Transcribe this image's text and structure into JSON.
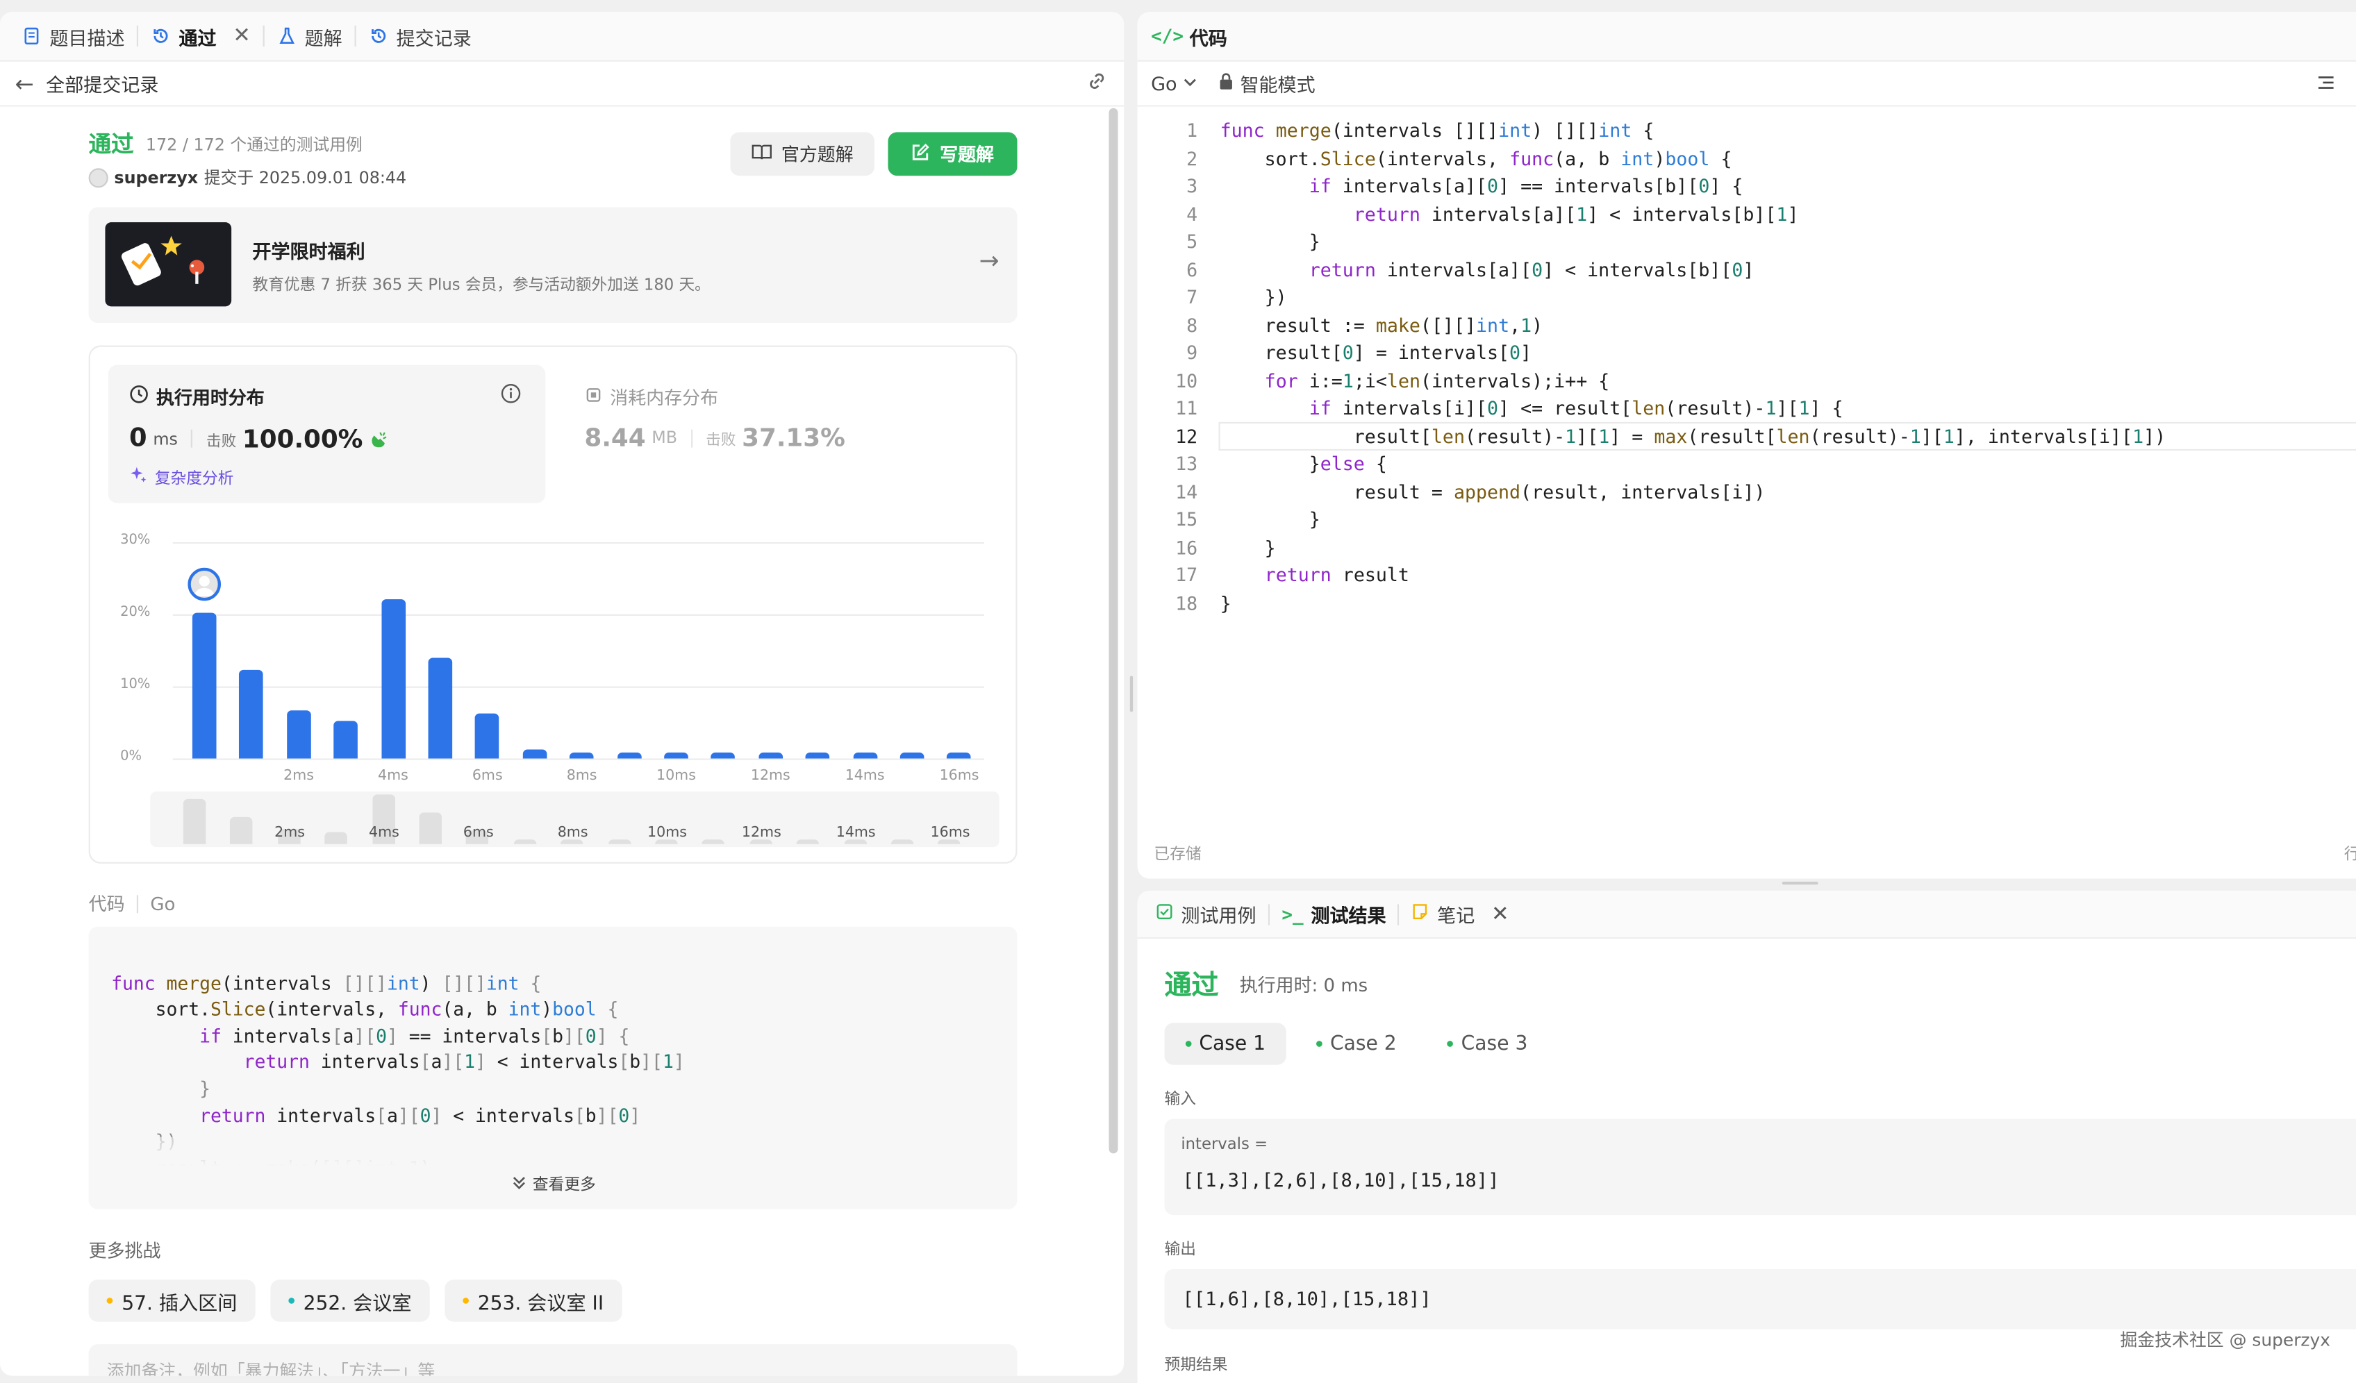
{
  "left_tabs": [
    {
      "label": "题目描述"
    },
    {
      "label": "通过"
    },
    {
      "label": "题解"
    },
    {
      "label": "提交记录"
    }
  ],
  "back_label": "全部提交记录",
  "submission": {
    "status": "通过",
    "passed_text": "172 / 172 个通过的测试用例",
    "user": "superzyx",
    "submitted_text": "提交于 2025.09.01 08:44",
    "official_btn": "官方题解",
    "write_btn": "写题解"
  },
  "promo": {
    "title": "开学限时福利",
    "desc": "教育优惠 7 折获 365 天 Plus 会员，参与活动额外加送 180 天。"
  },
  "runtime": {
    "title": "执行用时分布",
    "value": "0",
    "unit": "ms",
    "beat_label": "击败",
    "beat": "100.00%",
    "complexity": "复杂度分析"
  },
  "memory": {
    "title": "消耗内存分布",
    "value": "8.44",
    "unit": "MB",
    "beat_label": "击败",
    "beat": "37.13%"
  },
  "chart_data": {
    "type": "bar",
    "ylabels": [
      "30%",
      "20%",
      "10%",
      "0%"
    ],
    "ylim": [
      0,
      30
    ],
    "xlabels": [
      "2ms",
      "4ms",
      "6ms",
      "8ms",
      "10ms",
      "12ms",
      "14ms",
      "16ms"
    ],
    "values": [
      20.2,
      12.2,
      6.6,
      5.2,
      22,
      14,
      6.2,
      1.2,
      0.8,
      0.8,
      0.8,
      0.8,
      0.8,
      0.8,
      0.8,
      0.8,
      0.8
    ],
    "highlight_index": 0
  },
  "code_header": {
    "label": "代码",
    "lang": "Go"
  },
  "code_lines": [
    "func merge(intervals [][]int) [][]int {",
    "    sort.Slice(intervals, func(a, b int)bool {",
    "        if intervals[a][0] == intervals[b][0] {",
    "            return intervals[a][1] < intervals[b][1]",
    "        }",
    "        return intervals[a][0] < intervals[b][0]",
    "    })",
    "    result := make([][]int,1)",
    "    result[0] = intervals[0]",
    "    for i:=1;i<len(intervals);i++ {",
    "        if intervals[i][0] <= result[len(result)-1][1] {",
    "            result[len(result)-1][1] = max(result[len(result)-1][1], intervals[i][1])",
    "        }else {",
    "            result = append(result, intervals[i])",
    "        }",
    "    }",
    "    return result",
    "}"
  ],
  "view_more": "查看更多",
  "more_challenges": {
    "title": "更多挑战",
    "items": [
      {
        "label": "57. 插入区间",
        "color": "#ffb800"
      },
      {
        "label": "252. 会议室",
        "color": "#1cb8b8"
      },
      {
        "label": "253. 会议室 II",
        "color": "#ffb800"
      }
    ]
  },
  "note_placeholder": "添加备注，例如「暴力解法」、「方法一」等",
  "editor": {
    "title": "代码",
    "lang": "Go",
    "mode": "智能模式",
    "saved": "已存储",
    "right_edge": "行"
  },
  "bottom_tabs": [
    {
      "label": "测试用例"
    },
    {
      "label": "测试结果"
    },
    {
      "label": "笔记"
    }
  ],
  "result": {
    "status": "通过",
    "runtime": "执行用时: 0 ms",
    "cases": [
      "Case 1",
      "Case 2",
      "Case 3"
    ],
    "input_label": "输入",
    "input_var": "intervals =",
    "input_value": "[[1,3],[2,6],[8,10],[15,18]]",
    "output_label": "输出",
    "output_value": "[[1,6],[8,10],[15,18]]",
    "expected_label": "预期结果"
  },
  "watermark": "掘金技术社区 @ superzyx",
  "colors": {
    "accent": "#2d74e8",
    "success": "#2db55d",
    "brand_orange": "#ffa116"
  }
}
